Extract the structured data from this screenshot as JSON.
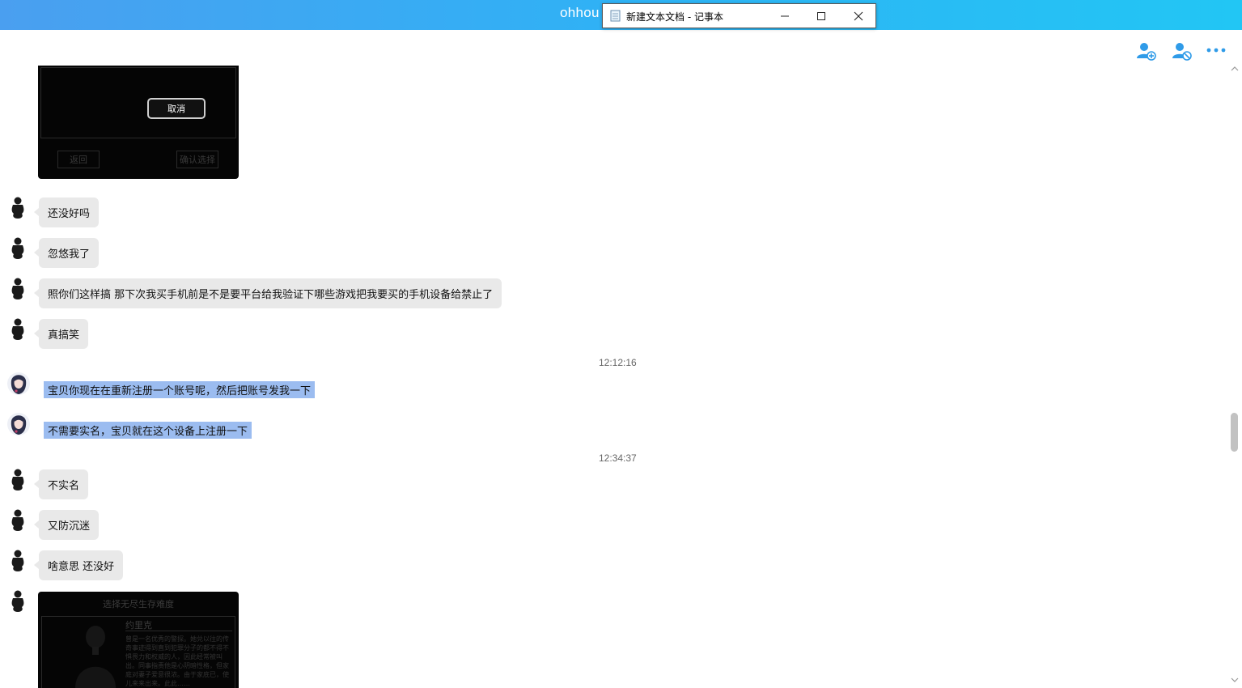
{
  "app": {
    "title_fragment": "ohhou"
  },
  "notepad": {
    "title": "新建文本文档 - 记事本",
    "min_icon": "minimize-icon",
    "max_icon": "maximize-icon",
    "close_icon": "close-icon"
  },
  "header_actions": [
    "add-user-icon",
    "block-user-icon",
    "more-icon"
  ],
  "colors": {
    "topbar_start": "#4a9ff0",
    "topbar_end": "#22c6f4",
    "accent_icon": "#2f9be8",
    "bubble_bg": "#e9e9e9",
    "selection_bg": "#9bbcf0"
  },
  "screenshot_top": {
    "cancel": "取消",
    "back": "返回",
    "confirm": "确认选择"
  },
  "messages": [
    {
      "text": "还没好吗"
    },
    {
      "text": "忽悠我了"
    },
    {
      "text": "照你们这样搞 那下次我买手机前是不是要平台给我验证下哪些游戏把我要买的手机设备给禁止了"
    },
    {
      "text": "真搞笑"
    },
    {
      "time": "12:12:16"
    },
    {
      "text": "宝贝你现在在重新注册一个账号呢，然后把账号发我一下"
    },
    {
      "text": "不需要实名，宝贝就在这个设备上注册一下"
    },
    {
      "time": "12:34:37"
    },
    {
      "text": "不实名"
    },
    {
      "text": "又防沉迷"
    },
    {
      "text": "啥意思 还没好"
    }
  ],
  "screenshot_bottom": {
    "heading": "选择无尽生存难度",
    "name": "约里克",
    "description": "曾是一名优秀的警探。她兑以往的传奇事迹得到直到犯罪分子的都不得不惧畏力和权威的人，因此经常被叫出。同事指责他是心阴暗性格，但家庭对妻子爱意很浓。由于家底已，使儿来来出来。此此……"
  }
}
